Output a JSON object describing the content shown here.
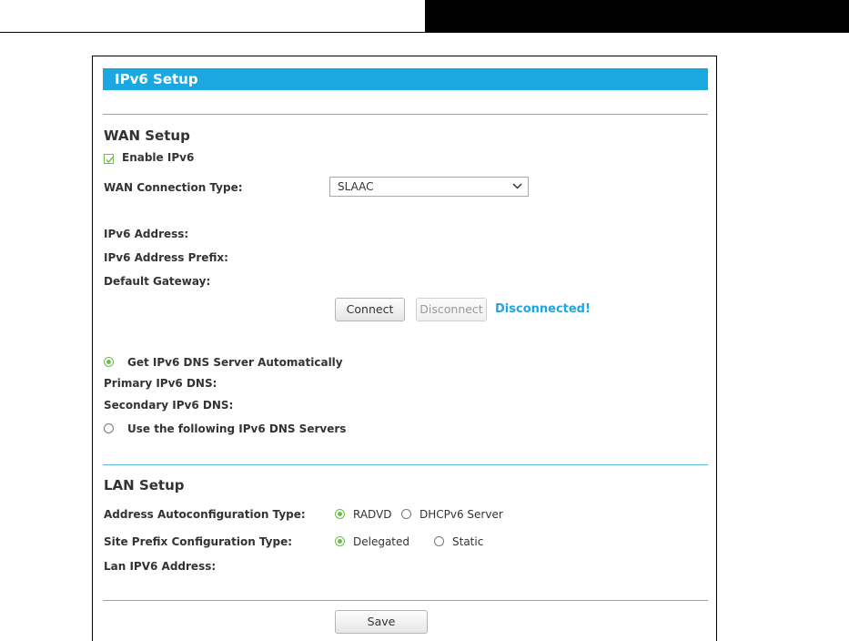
{
  "title": "IPv6 Setup",
  "wan": {
    "section_title": "WAN Setup",
    "enable_ipv6_label": "Enable IPv6",
    "enable_ipv6_checked": true,
    "connection_type_label": "WAN Connection Type:",
    "connection_type_value": "SLAAC",
    "ipv6_address_label": "IPv6 Address:",
    "ipv6_prefix_label": "IPv6 Address Prefix:",
    "default_gateway_label": "Default Gateway:",
    "connect_label": "Connect",
    "disconnect_label": "Disconnect",
    "status_text": "Disconnected!",
    "dns_auto_label": "Get IPv6 DNS Server Automatically",
    "primary_dns_label": "Primary IPv6 DNS:",
    "secondary_dns_label": "Secondary IPv6 DNS:",
    "dns_manual_label": "Use the following IPv6 DNS Servers"
  },
  "lan": {
    "section_title": "LAN Setup",
    "autoconfig_label": "Address Autoconfiguration Type:",
    "autoconfig_options": [
      "RADVD",
      "DHCPv6 Server"
    ],
    "autoconfig_selected": "RADVD",
    "prefix_config_label": "Site Prefix Configuration Type:",
    "prefix_config_options": [
      "Delegated",
      "Static"
    ],
    "prefix_config_selected": "Delegated",
    "lan_address_label": "Lan IPV6 Address:"
  },
  "save_label": "Save",
  "colors": {
    "accent": "#1ba8e1",
    "radio_checked": "#6bbf4e",
    "divider": "#5bb8d9"
  }
}
